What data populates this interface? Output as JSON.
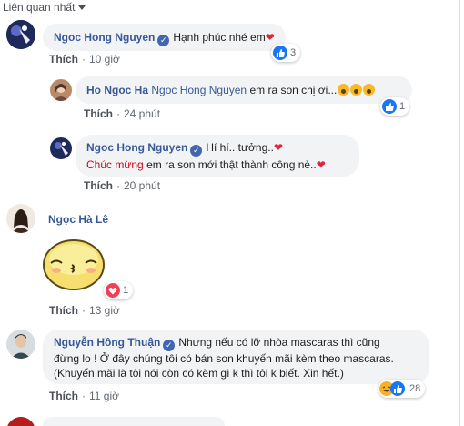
{
  "sort": {
    "label": "Liên quan nhất"
  },
  "comments": [
    {
      "name": "Ngoc Hong Nguyen",
      "text": "Hạnh phúc nhé em",
      "like_label": "Thích",
      "time": "10 giờ",
      "reaction_count": "3"
    },
    {
      "name": "Ho Ngoc Ha",
      "mention": "Ngoc Hong Nguyen",
      "text": "em ra son chị ơi...",
      "like_label": "Thích",
      "time": "24 phút",
      "reaction_count": "1"
    },
    {
      "name": "Ngoc Hong Nguyen",
      "text": "Hí hí.. tưởng..",
      "highlight": "Chúc mừng",
      "text2": "em ra son mới thật thành công nè..",
      "like_label": "Thích",
      "time": "20 phút"
    },
    {
      "name": "Ngọc Hà Lê",
      "like_label": "Thích",
      "time": "13 giờ",
      "reaction_count": "1"
    },
    {
      "name": "Nguyễn Hồng Thuận",
      "line1": "Nhưng nếu có lỡ nhòa mascaras thì cũng",
      "line2": "đừng lo ! Ở đây chúng tôi có bán son khuyến mãi kèm theo mascaras.",
      "line3": "(Khuyến mãi là tôi nói còn có kèm gì k thì tôi k biết. Xin hết.)",
      "like_label": "Thích",
      "time": "11 giờ",
      "reaction_count": "28"
    }
  ],
  "colors": {
    "link": "#385898",
    "bubble": "#f2f3f5",
    "like": "#1877f2",
    "love": "#f33e58"
  }
}
